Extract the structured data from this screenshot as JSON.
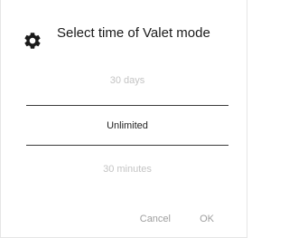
{
  "dialog": {
    "title": "Select time of Valet mode",
    "icon": "gear-icon",
    "options": [
      "30 days",
      "Unlimited",
      "30 minutes"
    ],
    "selected": "Unlimited",
    "cancel_label": "Cancel",
    "ok_label": "OK"
  },
  "colors": {
    "text_primary": "#1a1a1a",
    "text_dim": "#c4c4c4",
    "button_text": "#9e9e9e",
    "divider": "#3a3a3a"
  }
}
